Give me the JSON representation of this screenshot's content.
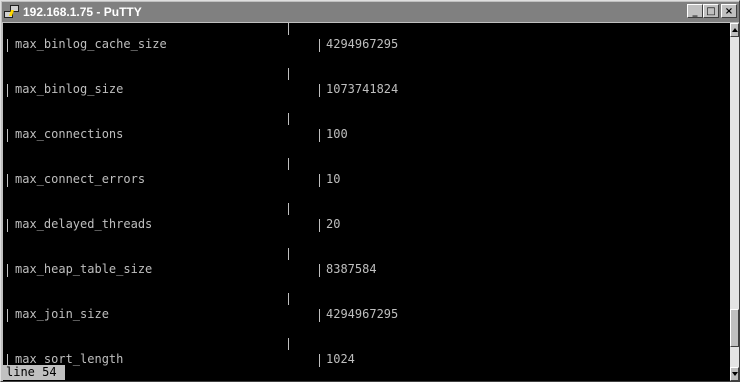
{
  "window": {
    "title": "192.168.1.75 - PuTTY",
    "buttons": {
      "minimize": "_",
      "maximize": "□",
      "close": "×"
    }
  },
  "terminal": {
    "rows": [
      {
        "name": "max_binlog_cache_size",
        "value": "4294967295"
      },
      {
        "name": "max_binlog_size",
        "value": "1073741824"
      },
      {
        "name": "max_connections",
        "value": "100"
      },
      {
        "name": "max_connect_errors",
        "value": "10"
      },
      {
        "name": "max_delayed_threads",
        "value": "20"
      },
      {
        "name": "max_heap_table_size",
        "value": "8387584"
      },
      {
        "name": "max_join_size",
        "value": "4294967295"
      },
      {
        "name": "max_sort_length",
        "value": "1024"
      }
    ],
    "status": "line 54"
  },
  "scrollbar": {
    "position_fraction": 0.93
  },
  "colors": {
    "terminal_bg": "#000000",
    "terminal_fg": "#bfbfbf",
    "titlebar_bg": "#808080",
    "chrome": "#c0c0c0"
  }
}
